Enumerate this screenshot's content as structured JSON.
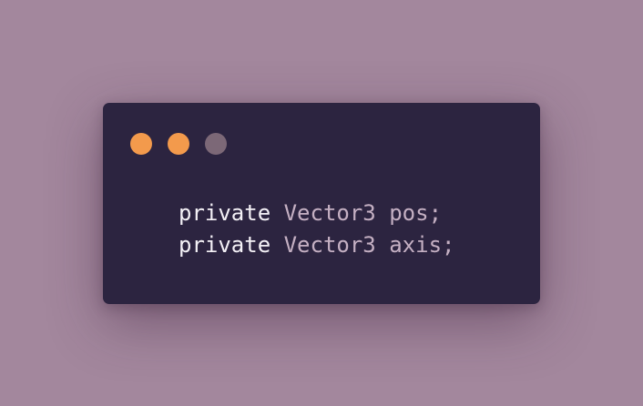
{
  "window": {
    "controls": [
      {
        "name": "close",
        "color": "#f39a4c"
      },
      {
        "name": "minimize",
        "color": "#f39a4c"
      },
      {
        "name": "maximize",
        "color": "#7c6877"
      }
    ]
  },
  "code": {
    "lines": [
      {
        "keyword": "private",
        "type": "Vector3",
        "rest": "pos;"
      },
      {
        "keyword": "private",
        "type": "Vector3",
        "rest": "axis;"
      }
    ]
  },
  "colors": {
    "background": "#a3879d",
    "window": "#2c2440",
    "keyword": "#f4f1f6",
    "text": "#c5b0c3"
  }
}
